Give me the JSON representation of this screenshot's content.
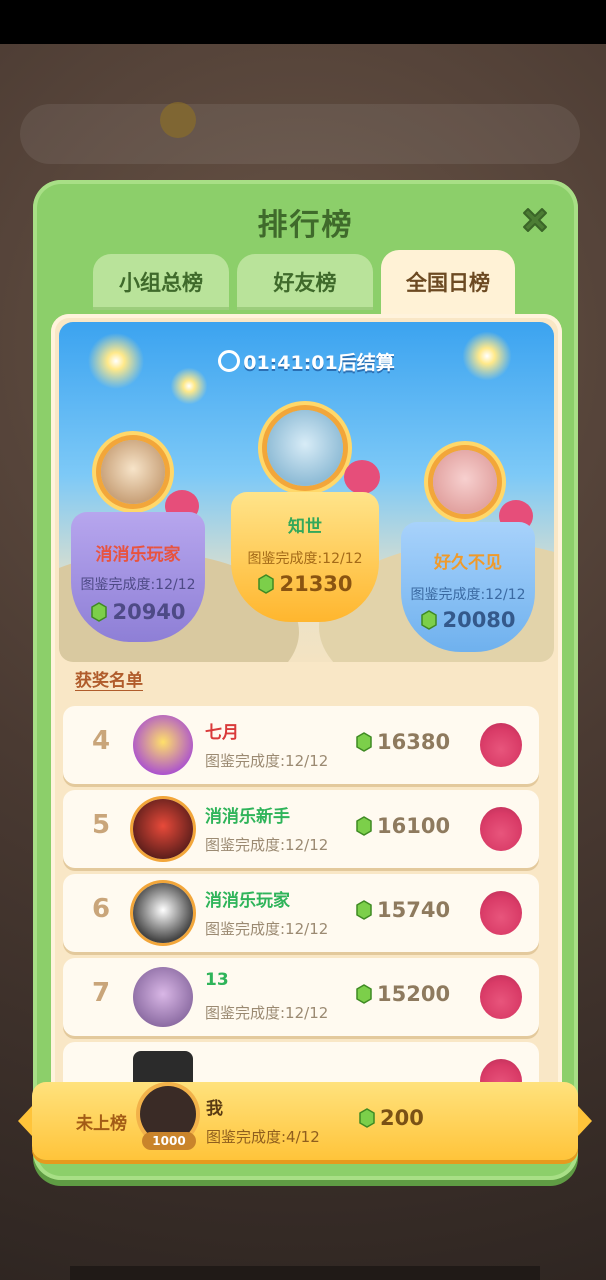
{
  "panel": {
    "title": "排行榜",
    "tabs": [
      {
        "label": "小组总榜",
        "active": false
      },
      {
        "label": "好友榜",
        "active": false
      },
      {
        "label": "全国日榜",
        "active": true
      }
    ]
  },
  "timer": {
    "time": "01:41:01",
    "suffix": "后结算"
  },
  "podium": {
    "first": {
      "name": "知世",
      "label": "图鉴完成度:12/12",
      "score": "21330"
    },
    "second": {
      "name": "消消乐玩家",
      "label": "图鉴完成度:12/12",
      "score": "20940"
    },
    "third": {
      "name": "好久不见",
      "label": "图鉴完成度:12/12",
      "score": "20080"
    }
  },
  "winners_title": "获奖名单",
  "rows": [
    {
      "rank": "4",
      "name": "七月",
      "label": "图鉴完成度:12/12",
      "score": "16380"
    },
    {
      "rank": "5",
      "name": "消消乐新手",
      "label": "图鉴完成度:12/12",
      "score": "16100"
    },
    {
      "rank": "6",
      "name": "消消乐玩家",
      "label": "图鉴完成度:12/12",
      "score": "15740"
    },
    {
      "rank": "7",
      "name": "13",
      "label": "图鉴完成度:12/12",
      "score": "15200"
    }
  ],
  "me": {
    "status": "未上榜",
    "level": "1000",
    "name": "我",
    "label": "图鉴完成度:4/12",
    "score": "200"
  },
  "colors": {
    "panel_green": "#8ccf6a",
    "content_cream": "#f9e7c6",
    "gold": "#ffc43a",
    "sky": "#3ba3f0"
  }
}
